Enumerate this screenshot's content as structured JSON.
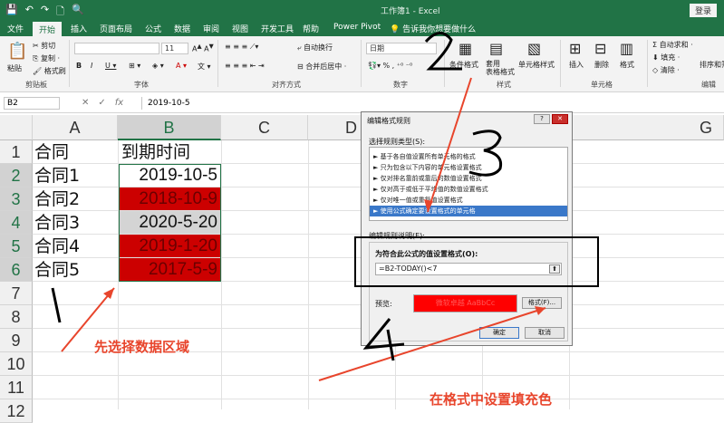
{
  "window": {
    "title": "工作簿1 - Excel",
    "login_label": "登录",
    "qat": [
      "💾",
      "↶",
      "↷",
      "🗋",
      "🔍"
    ]
  },
  "tabs": [
    {
      "label": "文件"
    },
    {
      "label": "开始",
      "active": true
    },
    {
      "label": "插入"
    },
    {
      "label": "页面布局"
    },
    {
      "label": "公式"
    },
    {
      "label": "数据"
    },
    {
      "label": "审阅"
    },
    {
      "label": "视图"
    },
    {
      "label": "开发工具"
    },
    {
      "label": "帮助"
    },
    {
      "label": "Power Pivot"
    },
    {
      "label": "告诉我你想要做什么"
    }
  ],
  "ribbon": {
    "clipboard": {
      "label": "剪贴板",
      "paste": "粘贴",
      "cut": "剪切",
      "copy": "复制 ·",
      "painter": "格式刷"
    },
    "font": {
      "label": "字体",
      "size": "11"
    },
    "align": {
      "label": "对齐方式",
      "wrap": "自动换行",
      "merge": "合并后居中 ·"
    },
    "number": {
      "label": "数字",
      "format": "日期"
    },
    "styles": {
      "label": "样式",
      "cond": "条件格式",
      "table": "套用\n表格格式",
      "cell": "单元格样式"
    },
    "cells": {
      "label": "单元格",
      "insert": "插入",
      "delete": "删除",
      "format": "格式"
    },
    "editing": {
      "label": "编辑",
      "autosum": "Σ 自动求和 ·",
      "fill": "填充 ·",
      "clear": "清除 ·",
      "sort": "排序和筛"
    }
  },
  "formula_bar": {
    "name_box": "B2",
    "value": "2019-10-5"
  },
  "grid": {
    "columns": [
      "A",
      "B",
      "C",
      "D",
      "E",
      "F",
      "G"
    ],
    "rows": [
      "1",
      "2",
      "3",
      "4",
      "5",
      "6",
      "7",
      "8",
      "9",
      "10",
      "11",
      "12"
    ],
    "col_a": [
      "合同",
      "合同1",
      "合同2",
      "合同3",
      "合同4",
      "合同5"
    ],
    "col_b": [
      "到期时间",
      "2019-10-5",
      "2018-10-9",
      "2020-5-20",
      "2019-1-20",
      "2017-5-9"
    ]
  },
  "dialog": {
    "title": "编辑格式规则",
    "select_type_label": "选择规则类型(S):",
    "rules": [
      "► 基于各自值设置所有单元格的格式",
      "► 只为包含以下内容的单元格设置格式",
      "► 仅对排名靠前或靠后的数值设置格式",
      "► 仅对高于或低于平均值的数值设置格式",
      "► 仅对唯一值或重复值设置格式",
      "► 使用公式确定要设置格式的单元格"
    ],
    "edit_desc_label": "编辑规则说明(E):",
    "formula_label": "为符合此公式的值设置格式(O):",
    "formula_value": "=B2-TODAY()<7",
    "preview_label": "预览:",
    "preview_text": "微软卓越 AaBbCc",
    "format_button": "格式(F)...",
    "ok_button": "确定",
    "cancel_button": "取消"
  },
  "annotations": {
    "step1": "1",
    "step2": "2",
    "step3": "3",
    "step4": "4",
    "note_select": "先选择数据区域",
    "note_fill": "在格式中设置填充色"
  },
  "colors": {
    "accent": "#217346",
    "red_fill": "#cc0000",
    "annotation": "#e8452c"
  }
}
